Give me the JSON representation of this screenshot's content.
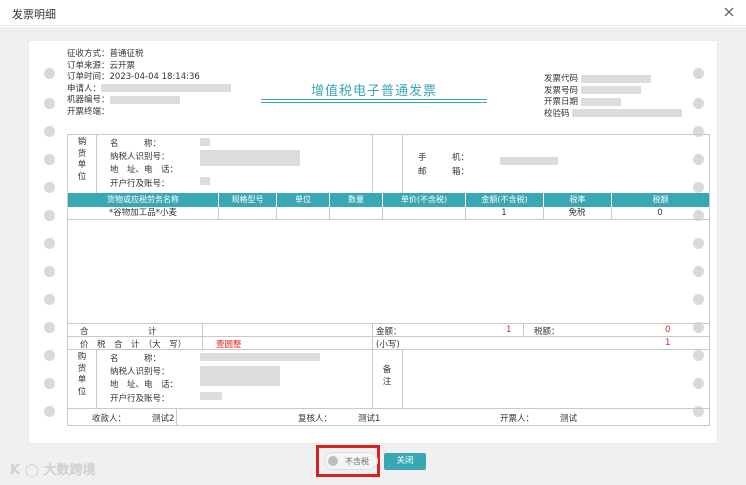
{
  "dialog": {
    "title": "发票明细"
  },
  "header_left": {
    "collection_method": "征收方式：普通征税",
    "order_source": "订单来源：云开票",
    "order_time": "订单时间：2023-04-04 18:14:36",
    "applicant": "申请人：",
    "machine_no": "机器编号：",
    "terminal": "开票终端："
  },
  "invoice_title": "增值税电子普通发票",
  "header_right": {
    "invoice_code": "发票代码",
    "invoice_number": "发票号码",
    "invoice_date": "开票日期",
    "check_code": "校验码"
  },
  "seller": {
    "side_chars": [
      "销",
      "货",
      "单",
      "位"
    ],
    "name": "名　　　称：",
    "taxpayer_id": "纳税人识别号：",
    "address_phone": "地　址、电　话：",
    "bank_account": "开户行及账号：",
    "mobile": "手　　　机：",
    "email": "邮　　　箱："
  },
  "columns": [
    "货物或应税劳务名称",
    "规格型号",
    "单位",
    "数量",
    "单价(不含税)",
    "金额(不含税)",
    "税率",
    "税额"
  ],
  "items": [
    {
      "name": "*谷物加工品*小麦",
      "spec": "",
      "unit": "",
      "qty": "",
      "price": "",
      "amount": "1",
      "rate": "免税",
      "tax": "0"
    }
  ],
  "totals": {
    "total_label": "合　　　　　　　计",
    "amount_label": "金额：",
    "amount": "1",
    "tax_label": "税额：",
    "tax": "0",
    "grand_label": "价　税　合　计　（大　写）",
    "grand_upper": "壹圆整",
    "small_label": "(小写)",
    "grand_lower": "1"
  },
  "buyer": {
    "side_chars": [
      "购",
      "货",
      "单",
      "位"
    ],
    "name": "名　　　称：",
    "taxpayer_id": "纳税人识别号：",
    "address_phone": "地　址、电　话：",
    "bank_account": "开户行及账号：",
    "remark_chars": [
      "备",
      "注"
    ]
  },
  "signatures": {
    "payee_label": "收款人：",
    "payee": "测试2",
    "reviewer_label": "复核人：",
    "reviewer": "测试1",
    "drawer_label": "开票人：",
    "drawer": "测试"
  },
  "footer": {
    "toggle_label": "不含税",
    "close_label": "关闭"
  },
  "watermark": "K ◯ 大数跨境",
  "colors": {
    "accent": "#3aa8b4",
    "red": "#e02020",
    "highlight_border": "#d6231f"
  }
}
